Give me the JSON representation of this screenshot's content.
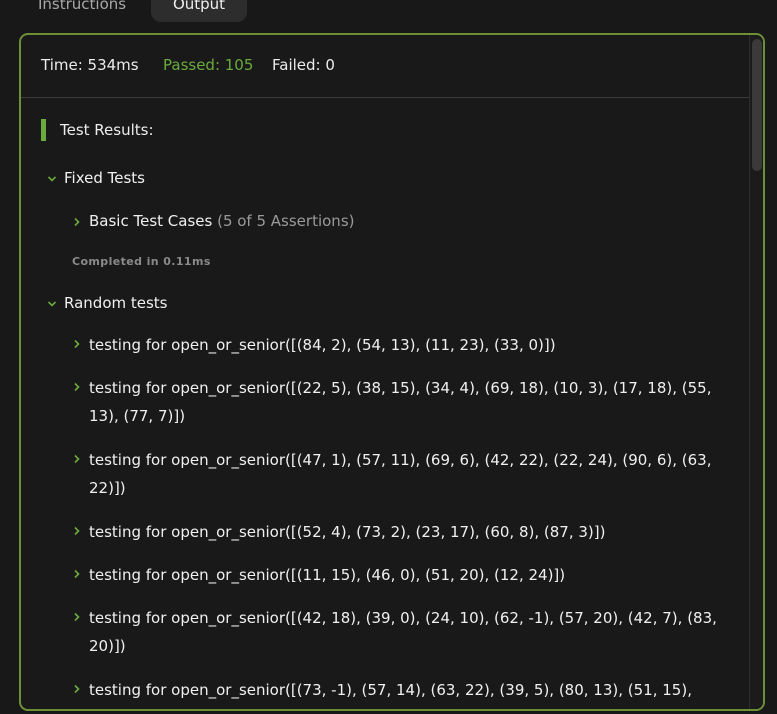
{
  "tabs": {
    "instructions": "Instructions",
    "output": "Output"
  },
  "summary": {
    "time": "Time: 534ms",
    "passed": "Passed: 105",
    "failed": "Failed: 0"
  },
  "results": {
    "title": "Test Results:",
    "groups": [
      {
        "label": "Fixed Tests",
        "expanded": true,
        "items": [
          {
            "label": "Basic Test Cases",
            "detail": "(5 of 5 Assertions)",
            "expanded": false
          }
        ],
        "completed": "Completed in 0.11ms"
      },
      {
        "label": "Random tests",
        "expanded": true,
        "items": [
          {
            "label": "testing for open_or_senior([(84, 2), (54, 13), (11, 23), (33, 0)])"
          },
          {
            "label": "testing for open_or_senior([(22, 5), (38, 15), (34, 4), (69, 18), (10, 3), (17, 18), (55, 13), (77, 7)])"
          },
          {
            "label": "testing for open_or_senior([(47, 1), (57, 11), (69, 6), (42, 22), (22, 24), (90, 6), (63, 22)])"
          },
          {
            "label": "testing for open_or_senior([(52, 4), (73, 2), (23, 17), (60, 8), (87, 3)])"
          },
          {
            "label": "testing for open_or_senior([(11, 15), (46, 0), (51, 20), (12, 24)])"
          },
          {
            "label": "testing for open_or_senior([(42, 18), (39, 0), (24, 10), (62, -1), (57, 20), (42, 7), (83, 20)])"
          },
          {
            "label": "testing for open_or_senior([(73, -1), (57, 14), (63, 22), (39, 5), (80, 13), (51, 15),"
          }
        ]
      }
    ]
  },
  "colors": {
    "accent": "#6aab3d",
    "border": "#6c8f38",
    "background": "#191919"
  }
}
